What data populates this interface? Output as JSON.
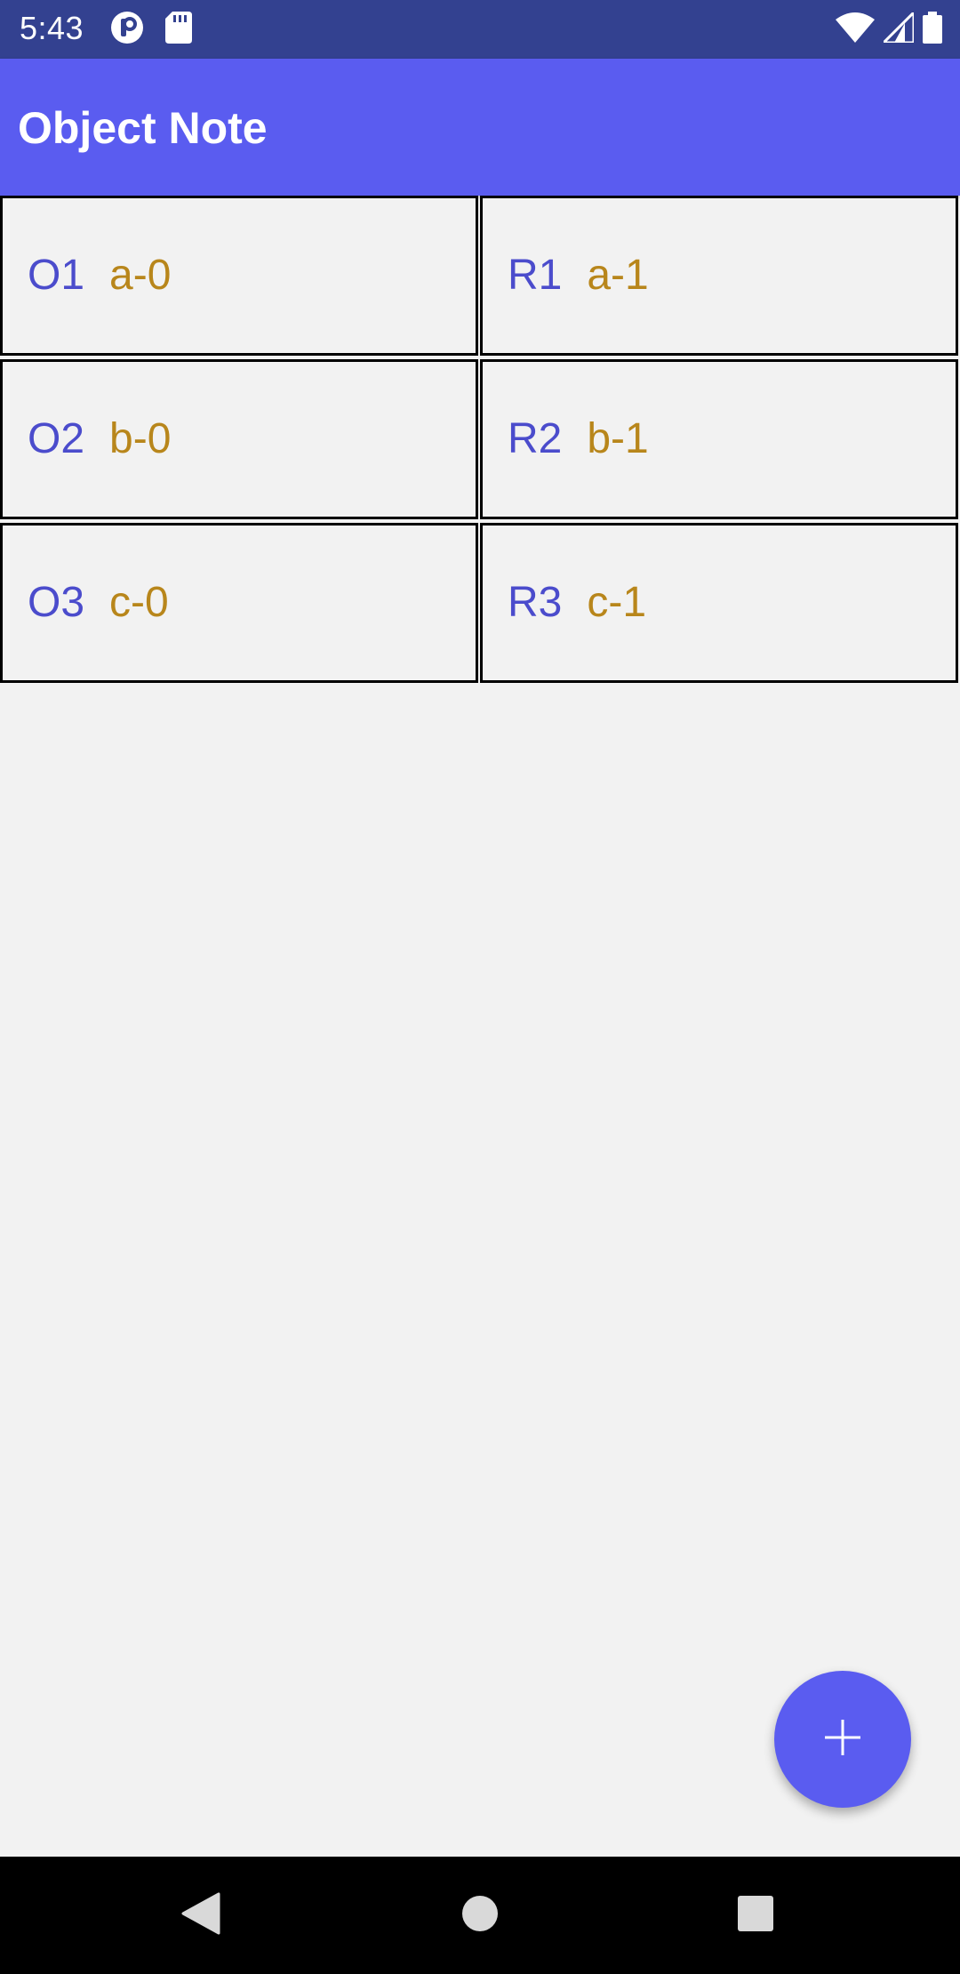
{
  "status_bar": {
    "time": "5:43",
    "left_icons": [
      "notification-app-icon",
      "sd-card-icon"
    ],
    "right_icons": [
      "wifi-icon",
      "signal-icon",
      "battery-icon"
    ]
  },
  "app_bar": {
    "title": "Object Note"
  },
  "grid": {
    "rows": [
      {
        "left": {
          "id": "O1",
          "value": "a-0"
        },
        "right": {
          "id": "R1",
          "value": "a-1"
        }
      },
      {
        "left": {
          "id": "O2",
          "value": "b-0"
        },
        "right": {
          "id": "R2",
          "value": "b-1"
        }
      },
      {
        "left": {
          "id": "O3",
          "value": "c-0"
        },
        "right": {
          "id": "R3",
          "value": "c-1"
        }
      }
    ]
  },
  "fab": {
    "icon": "plus-icon"
  },
  "nav_bar": {
    "buttons": [
      "back-icon",
      "home-icon",
      "recents-icon"
    ]
  },
  "colors": {
    "status_bar": "#334190",
    "app_bar": "#5a5cf0",
    "id_text": "#4b4ccc",
    "value_text": "#b8861b",
    "background": "#f2f2f2"
  }
}
